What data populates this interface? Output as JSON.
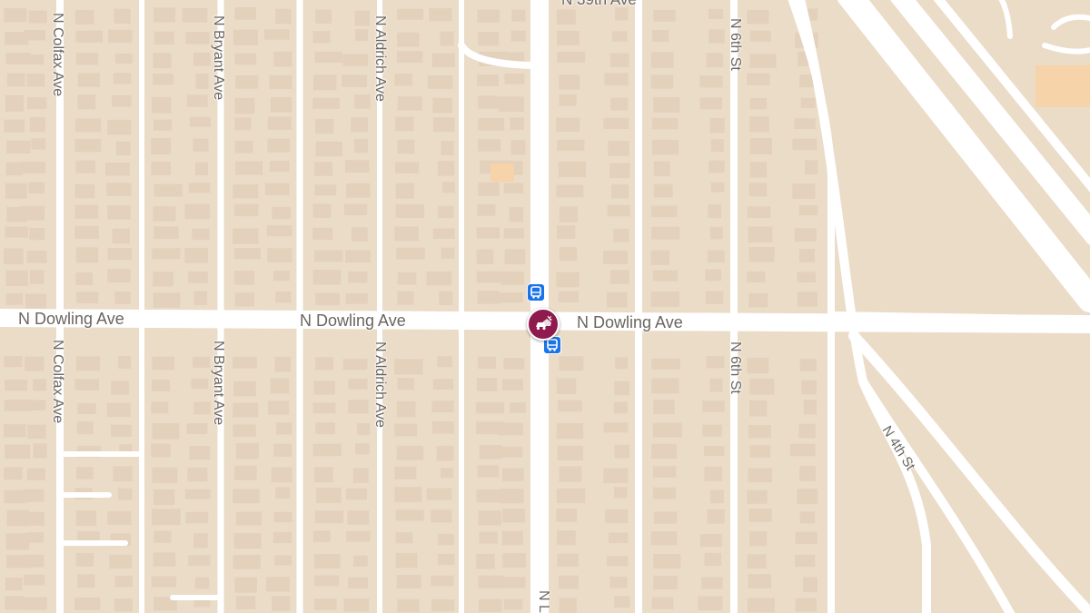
{
  "map": {
    "colors": {
      "land": "#ebdcc8",
      "road": "#ffffff",
      "building": "#e3d1bc",
      "highlight": "#f6d3a8",
      "transit": "#1a73e8",
      "incident": "#8e1a4e"
    },
    "streets": {
      "dowling_w": "N Dowling Ave",
      "dowling_c": "N Dowling Ave",
      "dowling_e": "N Dowling Ave",
      "colfax_n": "N Colfax Ave",
      "colfax_s": "N Colfax Ave",
      "bryant_n": "N Bryant Ave",
      "bryant_s": "N Bryant Ave",
      "aldrich_n": "N Aldrich Ave",
      "aldrich_s": "N Aldrich Ave",
      "sixth_n": "N 6th St",
      "sixth_s": "N 6th St",
      "fourth": "N 4th St",
      "top_partial": "N 39th Ave",
      "bottom_partial": "N L"
    },
    "icons": {
      "bus": "bus-stop-icon",
      "incident": "car-crash-icon"
    }
  }
}
